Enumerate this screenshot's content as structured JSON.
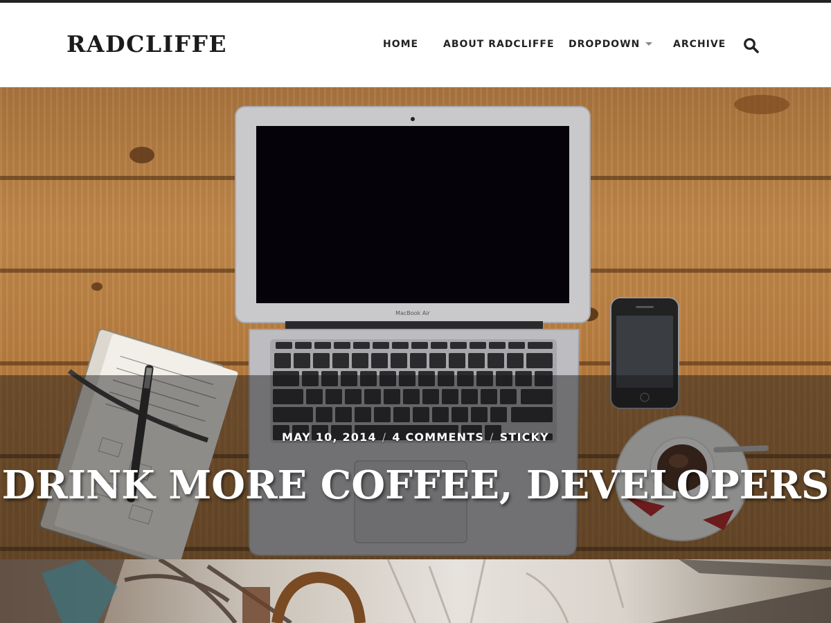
{
  "site": {
    "title": "RADCLIFFE"
  },
  "nav": {
    "items": [
      {
        "label": "HOME"
      },
      {
        "label": "ABOUT RADCLIFFE"
      },
      {
        "label": "DROPDOWN"
      },
      {
        "label": "ARCHIVE"
      }
    ],
    "search_icon": "search-icon"
  },
  "featured_post": {
    "date": "MAY 10, 2014",
    "comments": "4 COMMENTS",
    "category": "STICKY",
    "title": "DRINK MORE COFFEE, DEVELOPERS",
    "laptop_label": "MacBook Air"
  },
  "colors": {
    "topbar": "#222222",
    "text": "#222222",
    "overlay_text": "#ffffff"
  }
}
